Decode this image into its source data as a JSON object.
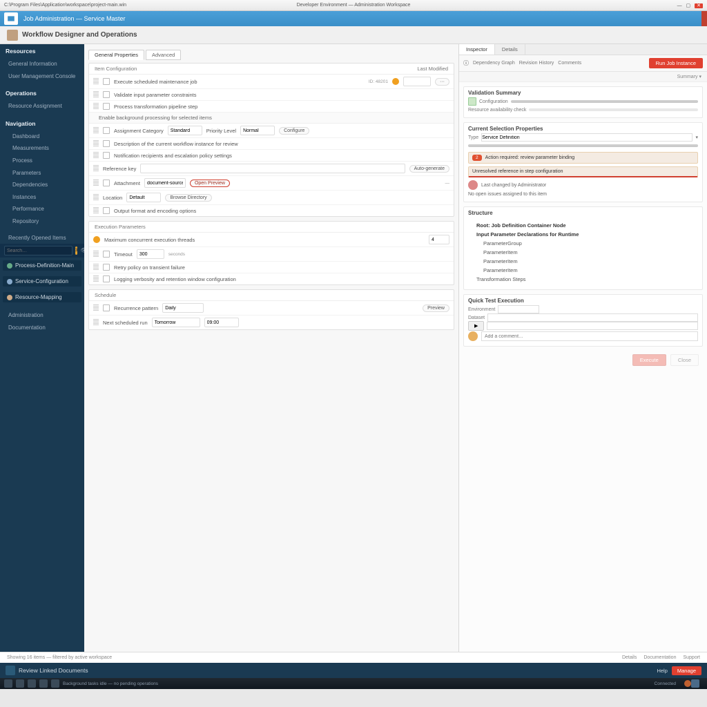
{
  "titlebar": {
    "path": "C:\\Program Files\\Application\\workspace\\project-main.win",
    "center": "Developer Environment — Administration Workspace"
  },
  "ribbon": {
    "title": "Job Administration — Service Master"
  },
  "subhead": {
    "title": "Workflow Designer and Operations"
  },
  "sidebar": {
    "s1": "Resources",
    "i1": "General Information",
    "i2": "User Management Console",
    "s2": "Operations",
    "i3": "Resource Assignment",
    "s3": "Navigation",
    "i4": "Dashboard",
    "i5": "Measurements",
    "i6": "Process",
    "i7": "Parameters",
    "i8": "Dependencies",
    "i9": "Instances",
    "i10": "Performance",
    "i11": "Repository",
    "s4": "Recently Opened Items",
    "search_ph": "Search…",
    "badge": "3",
    "r1": "Process-Definition-Main",
    "r2": "Service-Configuration",
    "r3": "Resource-Mapping",
    "i12": "Administration",
    "i13": "Documentation"
  },
  "center": {
    "tab1": "General Properties",
    "tab2": "Advanced",
    "blk1_head": "Item Configuration",
    "blk1_head_r": "Last Modified",
    "r1a": "Execute scheduled maintenance job",
    "r1b": "ID: 48201",
    "r2a": "Validate input parameter constraints",
    "r3a": "Process transformation pipeline step",
    "sub1": "Enable background processing for selected items",
    "r4a": "Assignment Category",
    "r4b": "Standard",
    "r4c": "Priority Level",
    "r4d": "Normal",
    "r4e": "Configure",
    "r5a": "Description of the current workflow instance for review",
    "r6a": "Notification recipients and escalation policy settings",
    "r7a": "Reference key",
    "r7b": "Auto-generate",
    "r8a": "Attachment",
    "r8b": "document-source",
    "r8c": "Open Preview",
    "r9a": "Location",
    "r9b": "Default",
    "r9c": "Browse Directory",
    "r10a": "Output format and encoding options",
    "blk2_head": "Execution Parameters",
    "r11a": "Maximum concurrent execution threads",
    "r11b": "4",
    "r12a": "Timeout",
    "r12b": "300",
    "r12c": "seconds",
    "r13a": "Retry policy on transient failure",
    "r14a": "Logging verbosity and retention window configuration",
    "blk3_head": "Schedule",
    "r15a": "Recurrence pattern",
    "r15b": "Daily",
    "r15c": "Preview",
    "r16a": "Next scheduled run",
    "r16b": "Tomorrow",
    "r16c": "09:00"
  },
  "right": {
    "tab1": "Inspector",
    "tab2": "Details",
    "tool1": "Dependency Graph",
    "tool2": "Revision History",
    "tool3": "Comments",
    "primary": "Run Job Instance",
    "drop": "Summary",
    "card1_h": "Validation Summary",
    "c1l1": "Configuration",
    "c1l2": "Resource availability check",
    "card2_h": "Current Selection Properties",
    "c2l1": "Type",
    "c2l2": "Service Definition",
    "hl_tag": "2",
    "hl_text": "Action required: review parameter binding",
    "hl2": "Unresolved reference in step configuration",
    "p1": "Last changed by Administrator",
    "p2": "No open issues assigned to this item",
    "tree_h": "Structure",
    "t1": "Root: Job Definition Container Node",
    "t2": "Input Parameter Declarations for Runtime",
    "t2a": "ParameterGroup",
    "t2b": "ParameterItem",
    "t2c": "ParameterItem",
    "t2d": "ParameterItem",
    "t3": "Transformation Steps",
    "card3_h": "Quick Test Execution",
    "c3l1": "Environment",
    "c3l2": "Dataset",
    "btn_run": "Execute",
    "btn_close": "Close",
    "comment_ph": "Add a comment…"
  },
  "status": {
    "left": "Showing 16 items — filtered by active workspace",
    "a": "Details",
    "b": "Documentation",
    "c": "Support"
  },
  "bottombar": {
    "title": "Review Linked Documents",
    "link1": "Help",
    "btn": "Manage"
  },
  "tray": {
    "t1": "Background tasks idle — no pending operations",
    "t2": "Connected"
  }
}
